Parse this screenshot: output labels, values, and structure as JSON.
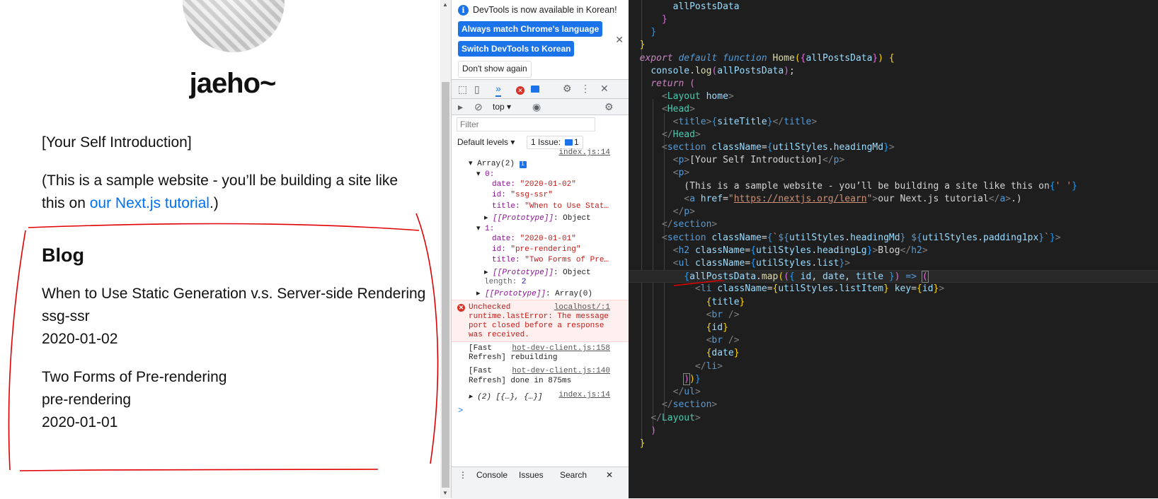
{
  "page": {
    "site_title": "jaeho~",
    "intro": "[Your Self Introduction]",
    "sample_before": "(This is a sample website - you’ll be building a site like this on ",
    "sample_link": "our Next.js tutorial",
    "sample_after": ".)",
    "blog_heading": "Blog",
    "posts": [
      {
        "title": "When to Use Static Generation v.s. Server-side Rendering",
        "id": "ssg-ssr",
        "date": "2020-01-02"
      },
      {
        "title": "Two Forms of Pre-rendering",
        "id": "pre-rendering",
        "date": "2020-01-01"
      }
    ],
    "annotation_color": "#e00000"
  },
  "devtools": {
    "info_text": "DevTools is now available in Korean!",
    "btn_match": "Always match Chrome's language",
    "btn_switch": "Switch DevTools to Korean",
    "btn_dont_show": "Don't show again",
    "context": "top",
    "filter_placeholder": "Filter",
    "default_levels": "Default levels ▾",
    "issue_label": "1 Issue:",
    "issue_count": "1",
    "log1_source": "index.js:14",
    "array_head": "Array(2)",
    "idx0": "0:",
    "idx0_date_key": "date:",
    "idx0_date": "\"2020-01-02\"",
    "idx0_id_key": "id:",
    "idx0_id": "\"ssg-ssr\"",
    "idx0_title_key": "title:",
    "idx0_title": "\"When to Use Stat…",
    "proto": "[[Prototype]]",
    "proto_obj": ": Object",
    "idx1": "1:",
    "idx1_date": "\"2020-01-01\"",
    "idx1_id": "\"pre-rendering\"",
    "idx1_title": "\"Two Forms of Pre…",
    "length_key": "length:",
    "length_val": "2",
    "proto_arr": ": Array(0)",
    "err_source": "localhost/:1",
    "err_l1": "Unchecked",
    "err_l2": "runtime.lastError: The message",
    "err_l3": "port closed before a response",
    "err_l4": "was received.",
    "fr1_a": "[Fast",
    "fr1_b": "Refresh] rebuilding",
    "fr1_source": "hot-dev-client.js:158",
    "fr2_a": "[Fast",
    "fr2_b": "Refresh] done in 875ms",
    "fr2_source": "hot-dev-client.js:140",
    "log2": "▸ (2) [{…}, {…}]",
    "log2_source": "index.js:14",
    "prompt": ">",
    "tabs": [
      "Console",
      "Issues",
      "Search"
    ]
  }
}
